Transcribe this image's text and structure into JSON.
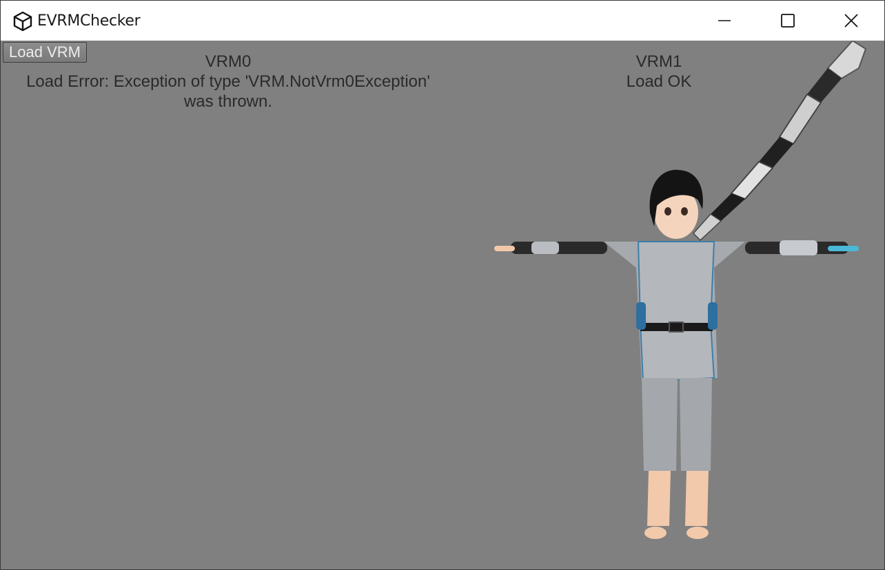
{
  "window": {
    "title": "EVRMChecker",
    "controls": {
      "minimize_icon": "minimize-icon",
      "maximize_icon": "maximize-icon",
      "close_icon": "close-icon"
    }
  },
  "toolbar": {
    "load_label": "Load VRM"
  },
  "vrm0": {
    "heading": "VRM0",
    "status_line1": "Load Error: Exception of type 'VRM.NotVrm0Exception'",
    "status_line2": "was thrown."
  },
  "vrm1": {
    "heading": "VRM1",
    "status": "Load OK"
  },
  "colors": {
    "viewport_bg": "#808080",
    "titlebar_bg": "#ffffff",
    "text": "#2a2a2a"
  }
}
